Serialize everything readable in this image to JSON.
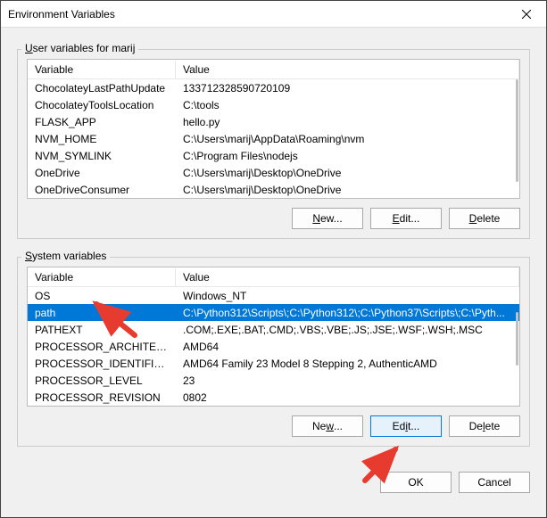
{
  "window": {
    "title": "Environment Variables"
  },
  "user_group": {
    "label_prefix": "U",
    "label_rest": "ser variables for marij",
    "columns": {
      "var": "Variable",
      "val": "Value"
    },
    "rows": [
      {
        "var": "ChocolateyLastPathUpdate",
        "val": "133712328590720109"
      },
      {
        "var": "ChocolateyToolsLocation",
        "val": "C:\\tools"
      },
      {
        "var": "FLASK_APP",
        "val": "hello.py"
      },
      {
        "var": "NVM_HOME",
        "val": "C:\\Users\\marij\\AppData\\Roaming\\nvm"
      },
      {
        "var": "NVM_SYMLINK",
        "val": "C:\\Program Files\\nodejs"
      },
      {
        "var": "OneDrive",
        "val": "C:\\Users\\marij\\Desktop\\OneDrive"
      },
      {
        "var": "OneDriveConsumer",
        "val": "C:\\Users\\marij\\Desktop\\OneDrive"
      }
    ],
    "buttons": {
      "new_u": "N",
      "new_rest": "ew...",
      "edit_u": "E",
      "edit_rest": "dit...",
      "delete_u": "D",
      "delete_rest": "elete"
    }
  },
  "system_group": {
    "label_prefix": "S",
    "label_rest": "ystem variables",
    "columns": {
      "var": "Variable",
      "val": "Value"
    },
    "rows": [
      {
        "var": "OS",
        "val": "Windows_NT"
      },
      {
        "var": "path",
        "val": "C:\\Python312\\Scripts\\;C:\\Python312\\;C:\\Python37\\Scripts\\;C:\\Pyth...",
        "selected": true
      },
      {
        "var": "PATHEXT",
        "val": ".COM;.EXE;.BAT;.CMD;.VBS;.VBE;.JS;.JSE;.WSF;.WSH;.MSC"
      },
      {
        "var": "PROCESSOR_ARCHITECTURE",
        "val": "AMD64"
      },
      {
        "var": "PROCESSOR_IDENTIFIER",
        "val": "AMD64 Family 23 Model 8 Stepping 2, AuthenticAMD"
      },
      {
        "var": "PROCESSOR_LEVEL",
        "val": "23"
      },
      {
        "var": "PROCESSOR_REVISION",
        "val": "0802"
      }
    ],
    "buttons": {
      "new_u": "w",
      "new_pre": "Ne",
      "new_rest": "...",
      "edit_u": "i",
      "edit_pre": "Ed",
      "edit_rest": "t...",
      "delete_u": "l",
      "delete_pre": "De",
      "delete_rest": "ete"
    }
  },
  "dialog_buttons": {
    "ok": "OK",
    "cancel": "Cancel"
  }
}
